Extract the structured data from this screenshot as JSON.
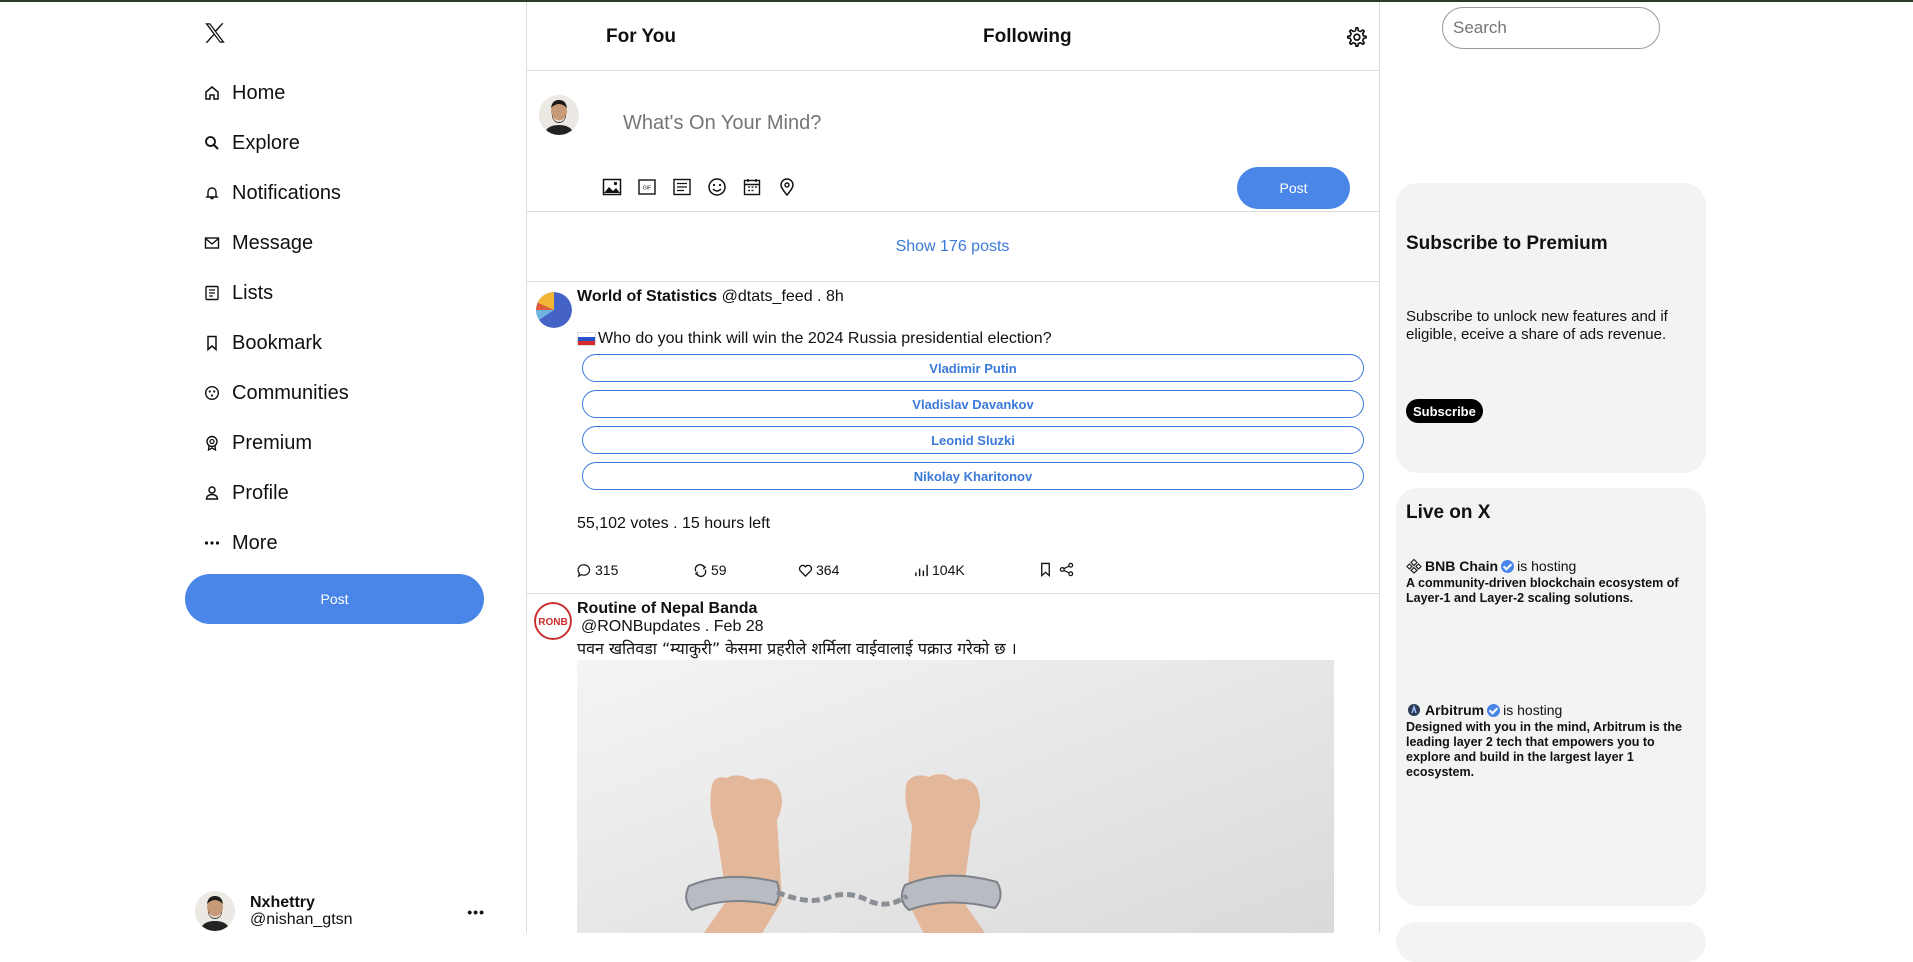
{
  "nav": {
    "items": [
      {
        "label": "Home",
        "icon": "home-icon"
      },
      {
        "label": "Explore",
        "icon": "search-icon"
      },
      {
        "label": "Notifications",
        "icon": "bell-icon"
      },
      {
        "label": "Message",
        "icon": "mail-icon"
      },
      {
        "label": "Lists",
        "icon": "list-icon"
      },
      {
        "label": "Bookmark",
        "icon": "bookmark-icon"
      },
      {
        "label": "Communities",
        "icon": "communities-icon"
      },
      {
        "label": "Premium",
        "icon": "premium-icon"
      },
      {
        "label": "Profile",
        "icon": "profile-icon"
      },
      {
        "label": "More",
        "icon": "more-icon"
      }
    ],
    "post_label": "Post"
  },
  "account": {
    "name": "Nxhettry",
    "handle": "@nishan_gtsn",
    "more": "•••"
  },
  "tabs": {
    "for_you": "For You",
    "following": "Following"
  },
  "composer": {
    "placeholder": "What's On Your Mind?",
    "post_label": "Post"
  },
  "feed": {
    "show_posts": "Show 176 posts",
    "tweet1": {
      "name": "World of Statistics",
      "handle": "@dtats_feed",
      "sep": ".",
      "time": "8h",
      "text": "Who do you think will win the 2024 Russia presidential election?",
      "poll": [
        "Vladimir Putin",
        "Vladislav Davankov",
        "Leonid Sluzki",
        "Nikolay Kharitonov"
      ],
      "votes": "55,102 votes",
      "time_left": "15 hours left",
      "replies": "315",
      "reposts": "59",
      "likes": "364",
      "views": "104K"
    },
    "tweet2": {
      "name": "Routine of Nepal Banda",
      "handle": "@RONBupdates",
      "sep": ".",
      "date": "Feb 28",
      "text": "पवन खतिवडा “म्याकुरी” केसमा प्रहरीले शर्मिला वाईवालाई पक्राउ गरेको छ ।",
      "avatar_text": "RONB"
    }
  },
  "right": {
    "search_placeholder": "Search",
    "premium": {
      "title": "Subscribe to Premium",
      "body": "Subscribe to unlock new features and if eligible, eceive a share of ads revenue.",
      "button": "Subscribe"
    },
    "live": {
      "title": "Live on X",
      "items": [
        {
          "host": "BNB Chain",
          "suffix": "is hosting",
          "desc": "A community-driven blockchain ecosystem of Layer-1 and Layer-2 scaling solutions."
        },
        {
          "host": "Arbitrum",
          "suffix": "is hosting",
          "desc": "Designed with you in the mind, Arbitrum is the leading layer 2 tech that empowers you to explore and build in the largest layer 1 ecosystem."
        }
      ]
    }
  },
  "colors": {
    "accent": "#4a86e8",
    "link": "#3b7ad9",
    "card_bg": "#f3f4f2"
  }
}
